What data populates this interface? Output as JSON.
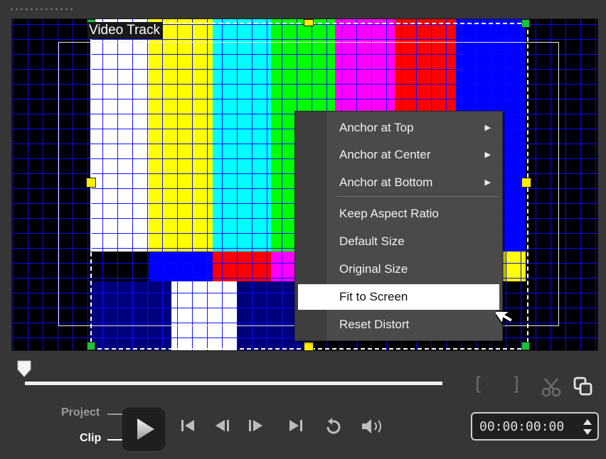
{
  "preview": {
    "track_label": "Video Track",
    "colors": {
      "white": "#ffffff",
      "yellow": "#ffff00",
      "cyan": "#00ffff",
      "green": "#00ff00",
      "magenta": "#ff00ff",
      "red": "#ff0000",
      "blue": "#0000ff",
      "navy": "#00007a",
      "handle_yellow": "#ffee00",
      "handle_green": "#19c43b"
    }
  },
  "context_menu": {
    "items": [
      {
        "label": "Anchor at Top",
        "submenu": true
      },
      {
        "label": "Anchor at Center",
        "submenu": true
      },
      {
        "label": "Anchor at Bottom",
        "submenu": true
      },
      {
        "label": "Keep Aspect Ratio",
        "submenu": false
      },
      {
        "label": "Default Size",
        "submenu": false
      },
      {
        "label": "Original Size",
        "submenu": false
      },
      {
        "label": "Fit to Screen",
        "submenu": false,
        "highlighted": true
      },
      {
        "label": "Reset Distort",
        "submenu": false
      }
    ]
  },
  "toolbar": {
    "mark_in_icon": "bracket-left-icon",
    "mark_out_icon": "bracket-right-icon",
    "split_icon": "scissors-icon",
    "copy_icon": "copy-icon"
  },
  "playback": {
    "project_label": "Project",
    "clip_label": "Clip",
    "timecode": "00:00:00:00"
  }
}
